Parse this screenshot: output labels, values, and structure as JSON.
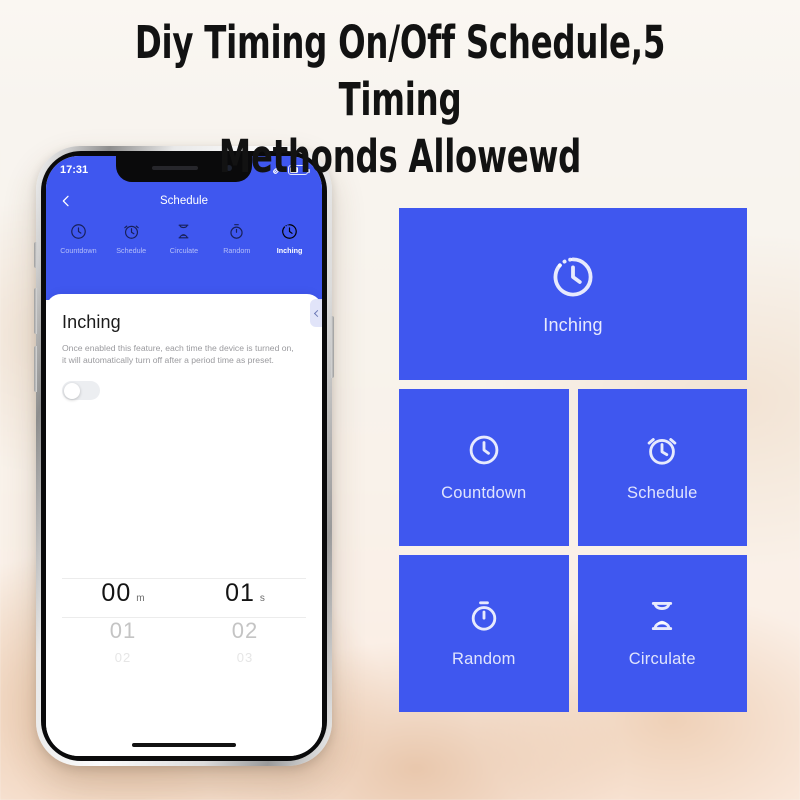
{
  "headline": {
    "line1": "Diy Timing On/Off Schedule,5 Timing",
    "line2": "Methonds Allowewd"
  },
  "colors": {
    "tile_blue": "#3f57ef",
    "page_background": "#f6f2ec",
    "headline_text": "#121212"
  },
  "phone": {
    "status_bar": {
      "time": "17:31",
      "link_icon": "link-icon",
      "battery_icon": "battery-icon"
    },
    "nav": {
      "back_icon": "chevron-left-icon",
      "title": "Schedule"
    },
    "tabs": [
      {
        "label": "Countdown",
        "icon": "clock-icon",
        "active": false
      },
      {
        "label": "Schedule",
        "icon": "alarm-clock-icon",
        "active": false
      },
      {
        "label": "Circulate",
        "icon": "hourglass-icon",
        "active": false
      },
      {
        "label": "Random",
        "icon": "stopwatch-icon",
        "active": false
      },
      {
        "label": "Inching",
        "icon": "dotted-clock-icon",
        "active": true
      }
    ],
    "side_handle_icon": "chevron-left-icon",
    "sheet": {
      "title": "Inching",
      "description": "Once enabled this feature,  each time the device is turned on, it will automatically turn off after a period time as preset.",
      "toggle_state": "off"
    },
    "picker": {
      "selected": [
        {
          "value": "00",
          "unit": "m"
        },
        {
          "value": "01",
          "unit": "s"
        }
      ],
      "next_row": [
        "01",
        "02"
      ],
      "faded_row": [
        "02",
        "03"
      ]
    }
  },
  "tiles": [
    {
      "label": "Inching",
      "icon": "dotted-clock-icon",
      "size": "wide"
    },
    {
      "label": "Countdown",
      "icon": "clock-icon",
      "size": "square"
    },
    {
      "label": "Schedule",
      "icon": "alarm-clock-icon",
      "size": "square"
    },
    {
      "label": "Random",
      "icon": "stopwatch-icon",
      "size": "square"
    },
    {
      "label": "Circulate",
      "icon": "hourglass-icon",
      "size": "square"
    }
  ]
}
